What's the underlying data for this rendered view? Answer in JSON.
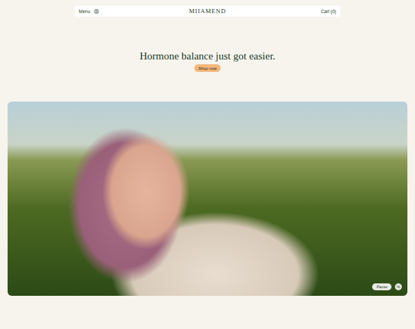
{
  "nav": {
    "menu": "Menu",
    "logo": "MIIAMEND",
    "cart": "Cart (0)"
  },
  "hero": {
    "headline": "Hormone balance just got easier.",
    "button": "Shop now"
  },
  "video": {
    "controls": [
      {
        "label": "Pause",
        "kind": "pill"
      },
      {
        "label": "%",
        "kind": "circle"
      }
    ]
  }
}
